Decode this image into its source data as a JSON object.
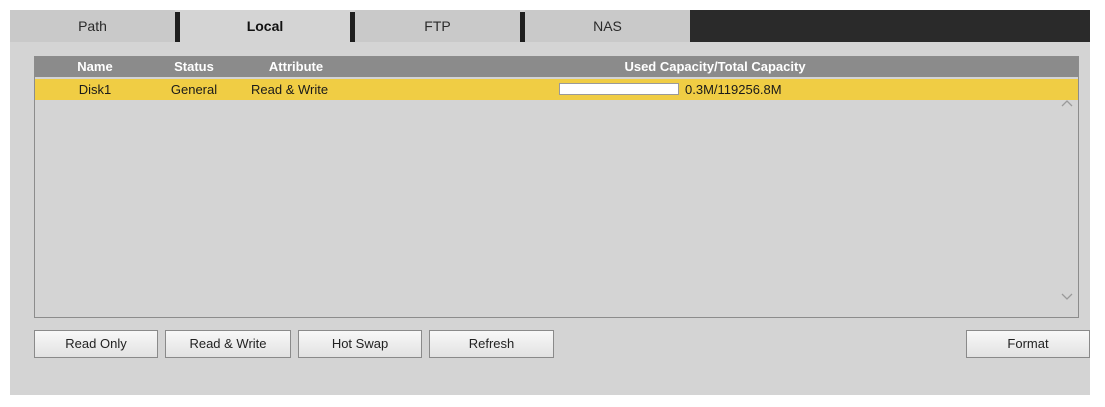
{
  "tabs": [
    {
      "label": "Path"
    },
    {
      "label": "Local"
    },
    {
      "label": "FTP"
    },
    {
      "label": "NAS"
    }
  ],
  "table": {
    "headers": {
      "name": "Name",
      "status": "Status",
      "attribute": "Attribute",
      "capacity": "Used Capacity/Total Capacity"
    },
    "rows": [
      {
        "name": "Disk1",
        "status": "General",
        "attribute": "Read & Write",
        "capacity": "0.3M/119256.8M",
        "used_fraction": 2.5e-06
      }
    ]
  },
  "buttons": {
    "read_only": "Read Only",
    "read_write": "Read & Write",
    "hot_swap": "Hot Swap",
    "refresh": "Refresh",
    "format": "Format"
  },
  "colors": {
    "selected_row": "#f0cd44",
    "header_bg": "#8b8b8b",
    "panel_bg": "#d4d4d4"
  },
  "icons": {
    "scroll_up": "chevron-up-icon",
    "scroll_down": "chevron-down-icon"
  }
}
